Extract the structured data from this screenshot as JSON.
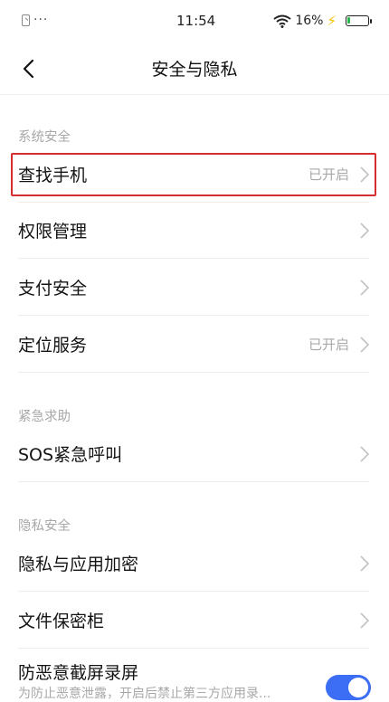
{
  "status_bar": {
    "dots": "···",
    "time": "11:54",
    "battery_percent": "16%",
    "battery_level": 0.16
  },
  "header": {
    "title": "安全与隐私"
  },
  "sections": {
    "system_security": {
      "title": "系统安全",
      "items": [
        {
          "label": "查找手机",
          "value": "已开启"
        },
        {
          "label": "权限管理",
          "value": ""
        },
        {
          "label": "支付安全",
          "value": ""
        },
        {
          "label": "定位服务",
          "value": "已开启"
        }
      ]
    },
    "emergency": {
      "title": "紧急求助",
      "items": [
        {
          "label": "SOS紧急呼叫",
          "value": ""
        }
      ]
    },
    "privacy": {
      "title": "隐私安全",
      "items": [
        {
          "label": "隐私与应用加密",
          "value": ""
        },
        {
          "label": "文件保密柜",
          "value": ""
        },
        {
          "label": "防恶意截屏录屏",
          "subtitle": "为防止恶意泄露，开启后禁止第三方应用录...",
          "toggle_on": true
        }
      ]
    }
  },
  "colors": {
    "highlight": "#d62d2d",
    "toggle_on": "#3b6ef5",
    "battery_fill": "#2db84d",
    "charging_bolt": "#f4c000"
  }
}
